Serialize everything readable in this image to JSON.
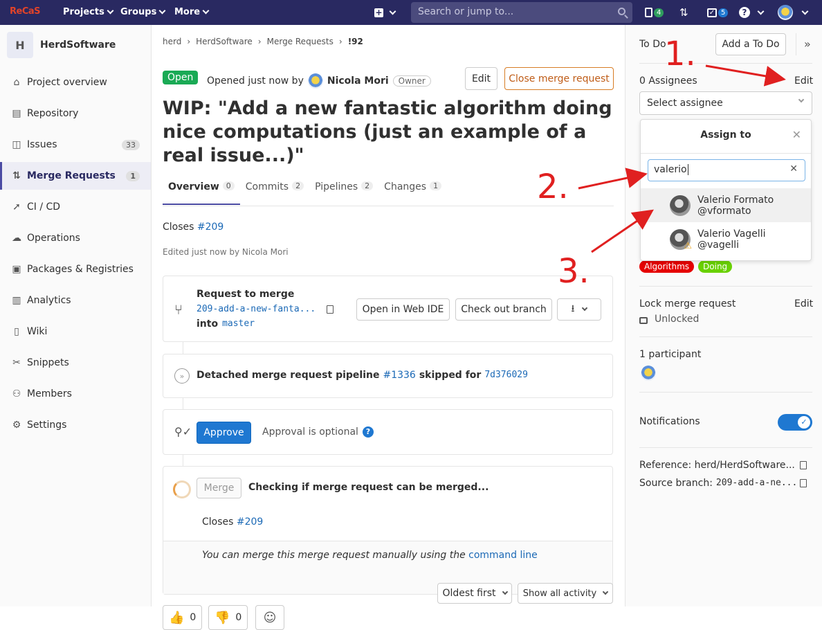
{
  "topbar": {
    "logo": "ReCaS",
    "menus": [
      "Projects",
      "Groups",
      "More"
    ],
    "search_placeholder": "Search or jump to...",
    "mr_badge": "4",
    "todo_badge": "5",
    "help": "?"
  },
  "sidebar": {
    "project_initial": "H",
    "project_name": "HerdSoftware",
    "items": [
      {
        "label": "Project overview",
        "icon": "home-icon"
      },
      {
        "label": "Repository",
        "icon": "repo-icon"
      },
      {
        "label": "Issues",
        "icon": "issues-icon",
        "count": "33"
      },
      {
        "label": "Merge Requests",
        "icon": "merge-request-icon",
        "count": "1"
      },
      {
        "label": "CI / CD",
        "icon": "rocket-icon"
      },
      {
        "label": "Operations",
        "icon": "cloud-icon"
      },
      {
        "label": "Packages & Registries",
        "icon": "package-icon"
      },
      {
        "label": "Analytics",
        "icon": "chart-icon"
      },
      {
        "label": "Wiki",
        "icon": "book-icon"
      },
      {
        "label": "Snippets",
        "icon": "scissors-icon"
      },
      {
        "label": "Members",
        "icon": "users-icon"
      },
      {
        "label": "Settings",
        "icon": "gear-icon"
      }
    ]
  },
  "breadcrumb": [
    "herd",
    "HerdSoftware",
    "Merge Requests",
    "!92"
  ],
  "mr": {
    "status": "Open",
    "opened_text": "Opened just now by",
    "author": "Nicola Mori",
    "role": "Owner",
    "edit_label": "Edit",
    "close_label": "Close merge request",
    "title": "WIP: \"Add a new fantastic algorithm doing nice computations (just an example of a real issue...)\"",
    "tabs": [
      {
        "label": "Overview",
        "count": "0"
      },
      {
        "label": "Commits",
        "count": "2"
      },
      {
        "label": "Pipelines",
        "count": "2"
      },
      {
        "label": "Changes",
        "count": "1"
      }
    ],
    "closes_prefix": "Closes",
    "closes_ref": "#209",
    "edited": "Edited just now by Nicola Mori"
  },
  "merge_widget": {
    "request_title": "Request to merge",
    "source_branch": "209-add-a-new-fanta...",
    "into": "into",
    "target_branch": "master",
    "web_ide": "Open in Web IDE",
    "checkout": "Check out branch",
    "pipeline_text": "Detached merge request pipeline",
    "pipeline_id": "#1336",
    "pipeline_skipped": "skipped for",
    "pipeline_sha": "7d376029",
    "approve": "Approve",
    "approval_text": "Approval is optional",
    "merge_btn": "Merge",
    "checking": "Checking if merge request can be merged...",
    "closes_prefix": "Closes",
    "closes_ref": "#209",
    "manual_text": "You can merge this merge request manually using the",
    "command_line": "command line"
  },
  "reactions": {
    "thumbs_up": "0",
    "thumbs_down": "0"
  },
  "activity": {
    "sort": "Oldest first",
    "filter": "Show all activity"
  },
  "right_sidebar": {
    "todo_label": "To Do",
    "add_todo": "Add a To Do",
    "assignees": "0 Assignees",
    "edit": "Edit",
    "select_assignee": "Select assignee",
    "labels": [
      "Algorithms",
      "Doing"
    ],
    "lock_title": "Lock merge request",
    "lock_edit": "Edit",
    "lock_status": "Unlocked",
    "participants": "1 participant",
    "notifications": "Notifications",
    "reference": "Reference: herd/HerdSoftware...",
    "source_label": "Source branch:",
    "source_value": "209-add-a-ne..."
  },
  "assign_dropdown": {
    "title": "Assign to",
    "search_value": "valerio",
    "users": [
      {
        "name": "Valerio Formato",
        "handle": "@vformato"
      },
      {
        "name": "Valerio Vagelli",
        "handle": "@vagelli"
      }
    ]
  },
  "annotations": [
    "1.",
    "2.",
    "3."
  ],
  "colors": {
    "topbar": "#292961",
    "annotation": "#e02020",
    "link": "#1b69b6",
    "open": "#1aaa55"
  }
}
